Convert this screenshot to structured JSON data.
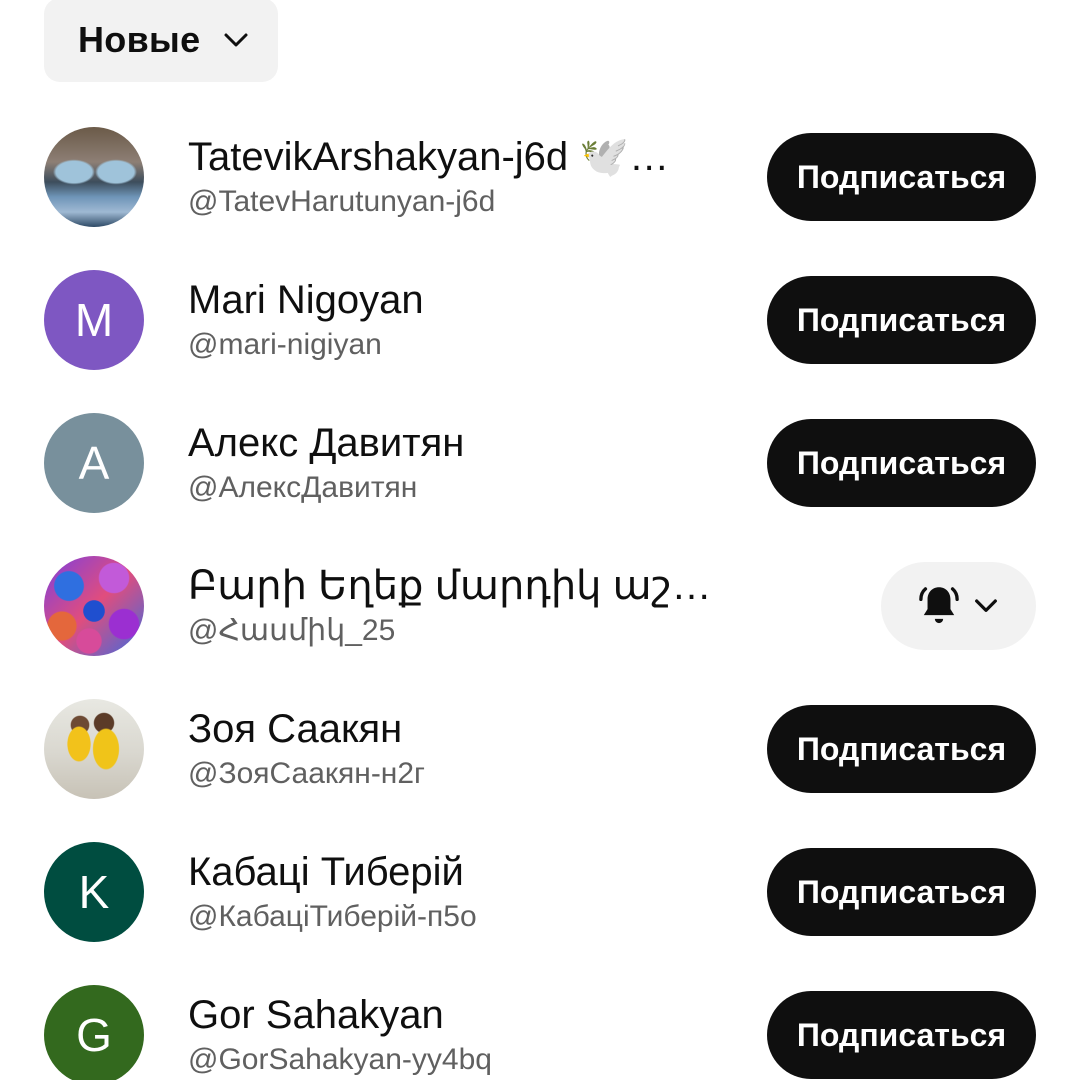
{
  "sort": {
    "label": "Новые"
  },
  "subscribers": [
    {
      "name": "TatevikArshakyan-j6d 🕊️…",
      "handle": "@TatevHarutunyan-j6d",
      "avatar_type": "photo-face",
      "avatar_letter": "",
      "avatar_color": "",
      "button": "subscribe"
    },
    {
      "name": "Mari Nigoyan",
      "handle": "@mari-nigiyan",
      "avatar_type": "letter",
      "avatar_letter": "M",
      "avatar_color": "#7e57c2",
      "button": "subscribe"
    },
    {
      "name": "Алекс Давитян",
      "handle": "@АлексДавитян",
      "avatar_type": "letter",
      "avatar_letter": "A",
      "avatar_color": "#78909c",
      "button": "subscribe"
    },
    {
      "name": "Բարի Եղեք մարդիկ աշխար...",
      "handle": "@Հասմիկ_25",
      "avatar_type": "photo-flowers",
      "avatar_letter": "",
      "avatar_color": "",
      "button": "bell"
    },
    {
      "name": "Зоя Саакян",
      "handle": "@ЗояСаакян-н2г",
      "avatar_type": "photo-kids",
      "avatar_letter": "",
      "avatar_color": "",
      "button": "subscribe"
    },
    {
      "name": "Кабаці Тиберій",
      "handle": "@КабаціТиберій-п5о",
      "avatar_type": "letter",
      "avatar_letter": "K",
      "avatar_color": "#004d40",
      "button": "subscribe"
    },
    {
      "name": "Gor Sahakyan",
      "handle": "@GorSahakyan-yy4bq",
      "avatar_type": "letter",
      "avatar_letter": "G",
      "avatar_color": "#33691e",
      "button": "subscribe"
    }
  ],
  "labels": {
    "subscribe": "Подписаться"
  },
  "icons": {
    "sort": "chevron-down-icon",
    "bell": "bell-icon",
    "bell_menu": "chevron-down-icon"
  },
  "colors": {
    "subscribe_bg": "#0f0f0f",
    "chip_bg": "#f2f2f2",
    "handle_text": "#606060"
  }
}
